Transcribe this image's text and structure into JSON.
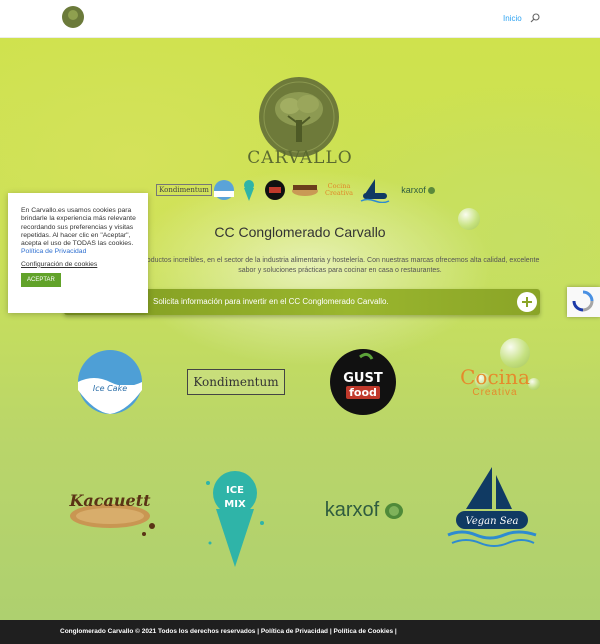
{
  "header": {
    "nav_home": "Inicio",
    "search_icon": "search-icon",
    "accent": "#2ea3f2"
  },
  "brand": {
    "name": "Carvallo",
    "strip_brands": [
      "Kondimentum",
      "Ice Cake",
      "Ice Cream Mix",
      "Gust Food",
      "Kacauett",
      "Cocina Creativa",
      "Vegan Sea",
      "karxof"
    ]
  },
  "section": {
    "title": "CC Conglomerado Carvallo",
    "description": "productos increíbles, en el sector de la industria alimentaria y hostelería. Con nuestras marcas ofrecemos alta calidad, excelente sabor y soluciones prácticas para cocinar en casa o restaurantes."
  },
  "cta": {
    "label": "Solicita información para invertir en el CC Conglomerado Carvallo.",
    "plus_icon": "plus-icon"
  },
  "grid": {
    "ice_cake_label": "Ice Cake",
    "kondimentum_label": "Kondimentum",
    "gust_line1": "GUST",
    "gust_line2": "food",
    "cocina_line1": "Cocina",
    "cocina_line2": "Creativa",
    "kacauett_label": "Kacauett",
    "icecream_line1": "ICE",
    "icecream_line2": "MIX",
    "karxof_label": "karxof",
    "vegan_label": "Vegan Sea"
  },
  "cookie": {
    "text": "En Carvallo.es usamos cookies para brindarle la experiencia más relevante recordando sus preferencias y visitas repetidas. Al hacer clic en \"Aceptar\", acepta el uso de TODAS las cookies.",
    "policy_link": "Política de Privacidad",
    "config_link": "Configuración de cookies",
    "accept_button": "ACEPTAR"
  },
  "footer": {
    "text": "Conglomerado Carvallo © 2021 Todos los derechos reservados | Política de Privacidad | Política de Cookies |"
  },
  "colors": {
    "brand_green": "#5b6a30",
    "cta_green": "#8aa427",
    "footer_bg": "#1f1f1f"
  }
}
